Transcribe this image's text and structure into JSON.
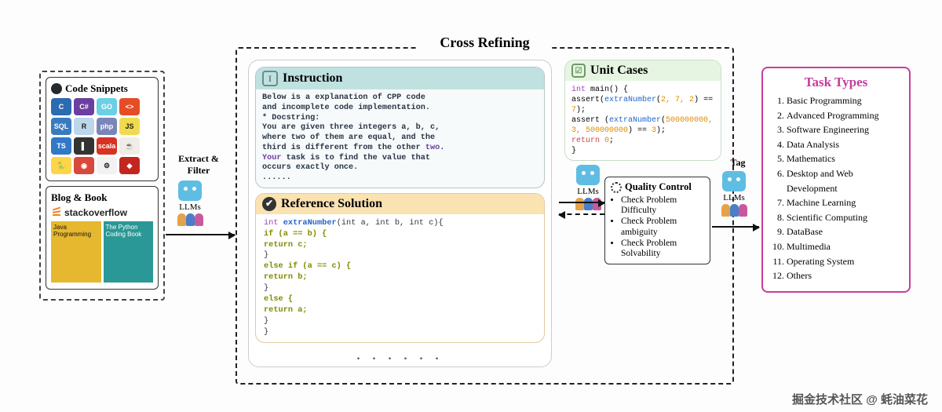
{
  "left": {
    "code_snippets_title": "Code Snippets",
    "langs": [
      {
        "t": "C",
        "bg": "#2c6bb0"
      },
      {
        "t": "C#",
        "bg": "#6b3fa0"
      },
      {
        "t": "GO",
        "bg": "#6ad0e4"
      },
      {
        "t": "<>",
        "bg": "#e44d26"
      },
      {
        "t": "SQL",
        "bg": "#3a7bbf"
      },
      {
        "t": "R",
        "bg": "#bcd6ea"
      },
      {
        "t": "php",
        "bg": "#7a86b8"
      },
      {
        "t": "JS",
        "bg": "#f0db4f"
      },
      {
        "t": "TS",
        "bg": "#3178c6"
      },
      {
        "t": "▌",
        "bg": "#333333"
      },
      {
        "t": "scala",
        "bg": "#d73222"
      },
      {
        "t": "☕",
        "bg": "#f0ede6"
      },
      {
        "t": "🐍",
        "bg": "#ffd548"
      },
      {
        "t": "◉",
        "bg": "#d9483b"
      },
      {
        "t": "⚙",
        "bg": "#f2f2f2"
      },
      {
        "t": "◆",
        "bg": "#c1271f"
      }
    ],
    "blog_book_title": "Blog & Book",
    "stackoverflow": "stackoverflow",
    "book1": "Java Programming",
    "book2": "The Python Coding Book"
  },
  "arrows": {
    "extract_filter": "Extract &\nFilter",
    "llms": "LLMs",
    "tag": "Tag"
  },
  "cross_refining": {
    "title": "Cross Refining",
    "instruction": {
      "title": "Instruction",
      "body_l1": "Below is a explanation of CPP code",
      "body_l2": "and incomplete code implementation.",
      "body_l3": " * Docstring:",
      "body_l4": "You are given three integers a, b, c,",
      "body_l5": "where two of them are equal, and the",
      "body_l6": "third is different from the other ",
      "body_kw1": "two",
      "body_l6b": ".",
      "body_kw2": "Your",
      "body_l7": " task is to find the value that",
      "body_l8": "occurs exactly once.",
      "body_l9": "......"
    },
    "unit_cases": {
      "title": "Unit Cases",
      "l1a": "int",
      "l1b": " main() {",
      "l2a": "  assert(",
      "l2b": "extraNumber",
      "l2c": "(",
      "l2n": "2, 7, 2",
      "l2d": ") == ",
      "l2e": "7",
      "l2f": ");",
      "l3a": "  assert (",
      "l3b": "extraNumber",
      "l3c": "(",
      "l3n": "500000000,",
      "l4n": "3, 500000000",
      "l4a": ") == ",
      "l4b": "3",
      "l4c": ");",
      "l5a": "  return",
      "l5b": " 0",
      "l6": ";",
      "l7": "}"
    },
    "reference": {
      "title": "Reference Solution",
      "l1a": "int ",
      "l1b": "extraNumber",
      "l1c": "(int a, int b, int c){",
      "l2": "   if (a == b) {",
      "l3": "      return c;",
      "l4": "   }",
      "l5": "   else if (a == c) {",
      "l6": "      return b;",
      "l7": "   }",
      "l8": "   else {",
      "l9": "      return a;",
      "l10": "   }",
      "l11": "}"
    }
  },
  "qc": {
    "title": "Quality Control",
    "items": [
      "Check Problem Difficulty",
      "Check Problem ambiguity",
      "Check Problem Solvability"
    ]
  },
  "task_types": {
    "title": "Task Types",
    "items": [
      "Basic Programming",
      "Advanced Programming",
      "Software Engineering",
      "Data Analysis",
      "Mathematics",
      "Desktop and Web Development",
      "Machine Learning",
      "Scientific Computing",
      "DataBase",
      "Multimedia",
      "Operating System",
      "Others"
    ]
  },
  "watermark": "掘金技术社区 @ 蚝油菜花"
}
